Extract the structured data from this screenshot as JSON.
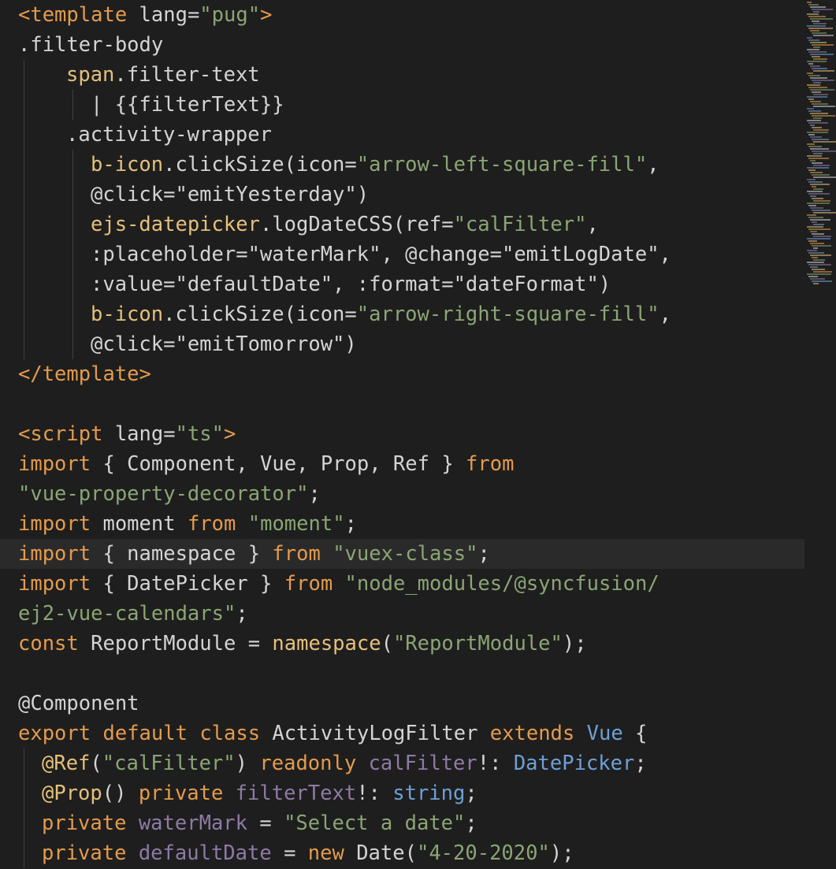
{
  "theme": {
    "background": "#1e1e1e",
    "keyword": "#e49b4d",
    "string": "#8ba574",
    "function": "#e5c07b",
    "property": "#8e7aa6",
    "type": "#6ea0d6",
    "text": "#d4d4d4"
  },
  "editor": {
    "highlighted_line": 18,
    "lines": [
      [
        [
          "<template ",
          "t-tag"
        ],
        [
          "lang=",
          "t-attr"
        ],
        [
          "\"pug\"",
          "t-str"
        ],
        [
          ">",
          "t-tag"
        ]
      ],
      [
        [
          ".filter-body",
          "t-def"
        ]
      ],
      [
        [
          "span",
          "t-fn"
        ],
        [
          ".filter-text",
          "t-def"
        ]
      ],
      [
        [
          "| {{filterText}}",
          "t-def"
        ]
      ],
      [
        [
          ".activity-wrapper",
          "t-def"
        ]
      ],
      [
        [
          "b-icon",
          "t-fn"
        ],
        [
          ".clickSize(icon=",
          "t-def"
        ],
        [
          "\"arrow-left-square-fill\"",
          "t-str"
        ],
        [
          ",",
          "t-def"
        ]
      ],
      [
        [
          "@click=\"emitYesterday\")",
          "t-def"
        ]
      ],
      [
        [
          "ejs-datepicker",
          "t-fn"
        ],
        [
          ".logDateCSS(ref=",
          "t-def"
        ],
        [
          "\"calFilter\"",
          "t-str"
        ],
        [
          ",",
          "t-def"
        ]
      ],
      [
        [
          ":placeholder=\"waterMark\", @change=\"emitLogDate\",",
          "t-def"
        ]
      ],
      [
        [
          ":value=\"defaultDate\", :format=\"dateFormat\")",
          "t-def"
        ]
      ],
      [
        [
          "b-icon",
          "t-fn"
        ],
        [
          ".clickSize(icon=",
          "t-def"
        ],
        [
          "\"arrow-right-square-fill\"",
          "t-str"
        ],
        [
          ",",
          "t-def"
        ]
      ],
      [
        [
          "@click=\"emitTomorrow\")",
          "t-def"
        ]
      ],
      [
        [
          "</template>",
          "t-tag"
        ]
      ],
      [],
      [
        [
          "<script ",
          "t-tag"
        ],
        [
          "lang=",
          "t-attr"
        ],
        [
          "\"ts\"",
          "t-str"
        ],
        [
          ">",
          "t-tag"
        ]
      ],
      [
        [
          "import",
          "t-kw"
        ],
        [
          " { Component, Vue, Prop, Ref } ",
          "t-def"
        ],
        [
          "from",
          "t-kw"
        ]
      ],
      [
        [
          "\"vue-property-decorator\"",
          "t-str"
        ],
        [
          ";",
          "t-def"
        ]
      ],
      [
        [
          "import",
          "t-kw"
        ],
        [
          " moment ",
          "t-def"
        ],
        [
          "from",
          "t-kw"
        ],
        [
          " ",
          "t-def"
        ],
        [
          "\"moment\"",
          "t-str"
        ],
        [
          ";",
          "t-def"
        ]
      ],
      [
        [
          "import",
          "t-kw"
        ],
        [
          " { namespace } ",
          "t-def"
        ],
        [
          "from",
          "t-kw"
        ],
        [
          " ",
          "t-def"
        ],
        [
          "\"vuex-class\"",
          "t-str"
        ],
        [
          ";",
          "t-def"
        ]
      ],
      [
        [
          "import",
          "t-kw"
        ],
        [
          " { DatePicker } ",
          "t-def"
        ],
        [
          "from",
          "t-kw"
        ],
        [
          " ",
          "t-def"
        ],
        [
          "\"node_modules/@syncfusion/",
          "t-str"
        ]
      ],
      [
        [
          "ej2-vue-calendars\"",
          "t-str"
        ],
        [
          ";",
          "t-def"
        ]
      ],
      [
        [
          "const",
          "t-kw"
        ],
        [
          " ReportModule = ",
          "t-def"
        ],
        [
          "namespace",
          "t-fn"
        ],
        [
          "(",
          "t-def"
        ],
        [
          "\"ReportModule\"",
          "t-str"
        ],
        [
          ");",
          "t-def"
        ]
      ],
      [],
      [
        [
          "@Component",
          "t-dec"
        ]
      ],
      [
        [
          "export",
          "t-kw"
        ],
        [
          " ",
          "t-def"
        ],
        [
          "default",
          "t-kw"
        ],
        [
          " ",
          "t-def"
        ],
        [
          "class",
          "t-kw"
        ],
        [
          " ActivityLogFilter ",
          "t-def"
        ],
        [
          "extends",
          "t-kw"
        ],
        [
          " ",
          "t-def"
        ],
        [
          "Vue",
          "t-type"
        ],
        [
          " {",
          "t-def"
        ]
      ],
      [
        [
          "@Ref",
          "t-fn"
        ],
        [
          "(",
          "t-def"
        ],
        [
          "\"calFilter\"",
          "t-str"
        ],
        [
          ") ",
          "t-def"
        ],
        [
          "readonly",
          "t-kw"
        ],
        [
          " ",
          "t-def"
        ],
        [
          "calFilter",
          "t-prop"
        ],
        [
          "!: ",
          "t-def"
        ],
        [
          "DatePicker",
          "t-type"
        ],
        [
          ";",
          "t-def"
        ]
      ],
      [
        [
          "@Prop",
          "t-fn"
        ],
        [
          "() ",
          "t-def"
        ],
        [
          "private",
          "t-kw"
        ],
        [
          " ",
          "t-def"
        ],
        [
          "filterText",
          "t-prop"
        ],
        [
          "!: ",
          "t-def"
        ],
        [
          "string",
          "t-type"
        ],
        [
          ";",
          "t-def"
        ]
      ],
      [
        [
          "private",
          "t-kw"
        ],
        [
          " ",
          "t-def"
        ],
        [
          "waterMark",
          "t-prop"
        ],
        [
          " = ",
          "t-def"
        ],
        [
          "\"Select a date\"",
          "t-str"
        ],
        [
          ";",
          "t-def"
        ]
      ],
      [
        [
          "private",
          "t-kw"
        ],
        [
          " ",
          "t-def"
        ],
        [
          "defaultDate",
          "t-prop"
        ],
        [
          " = ",
          "t-def"
        ],
        [
          "new",
          "t-kw"
        ],
        [
          " Date(",
          "t-def"
        ],
        [
          "\"4-20-2020\"",
          "t-str"
        ],
        [
          ");",
          "t-def"
        ]
      ]
    ]
  }
}
